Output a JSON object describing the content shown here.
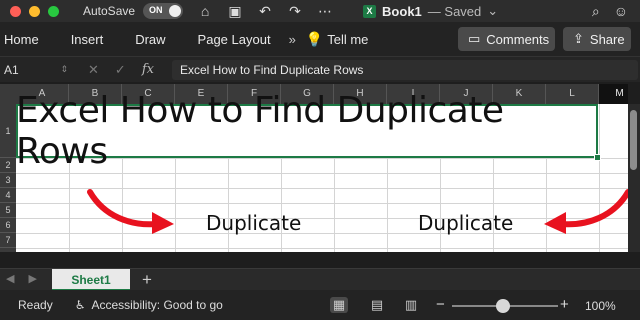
{
  "titlebar": {
    "autosave_label": "AutoSave",
    "autosave_state": "ON",
    "app_badge": "X",
    "doc_name": "Book1",
    "doc_status": "— Saved",
    "doc_menu_chevron": "⌄"
  },
  "ribbon": {
    "tabs": [
      "Home",
      "Insert",
      "Draw",
      "Page Layout"
    ],
    "more": "»",
    "tell_me": "Tell me",
    "comments_label": "Comments",
    "share_label": "Share"
  },
  "formula_bar": {
    "name_box": "A1",
    "fx_label": "fx",
    "formula": "Excel How to Find Duplicate Rows"
  },
  "sheet": {
    "columns": [
      "A",
      "B",
      "C",
      "E",
      "F",
      "G",
      "H",
      "I",
      "J",
      "K",
      "L",
      "M"
    ],
    "rows": [
      "1",
      "2",
      "3",
      "4",
      "5",
      "6",
      "7"
    ],
    "a1_text": "Excel How to Find Duplicate Rows",
    "label_left": "Duplicate",
    "label_right": "Duplicate",
    "arrow_color": "#e8121f"
  },
  "tabs": {
    "active_sheet": "Sheet1",
    "add_sheet": "+"
  },
  "status": {
    "ready": "Ready",
    "accessibility": "Accessibility: Good to go",
    "zoom_minus": "−",
    "zoom_plus": "+",
    "zoom_percent": "100%",
    "zoom_level": 1.0
  },
  "colors": {
    "excel_green": "#1d7a45",
    "arrow_red": "#e8121f"
  }
}
